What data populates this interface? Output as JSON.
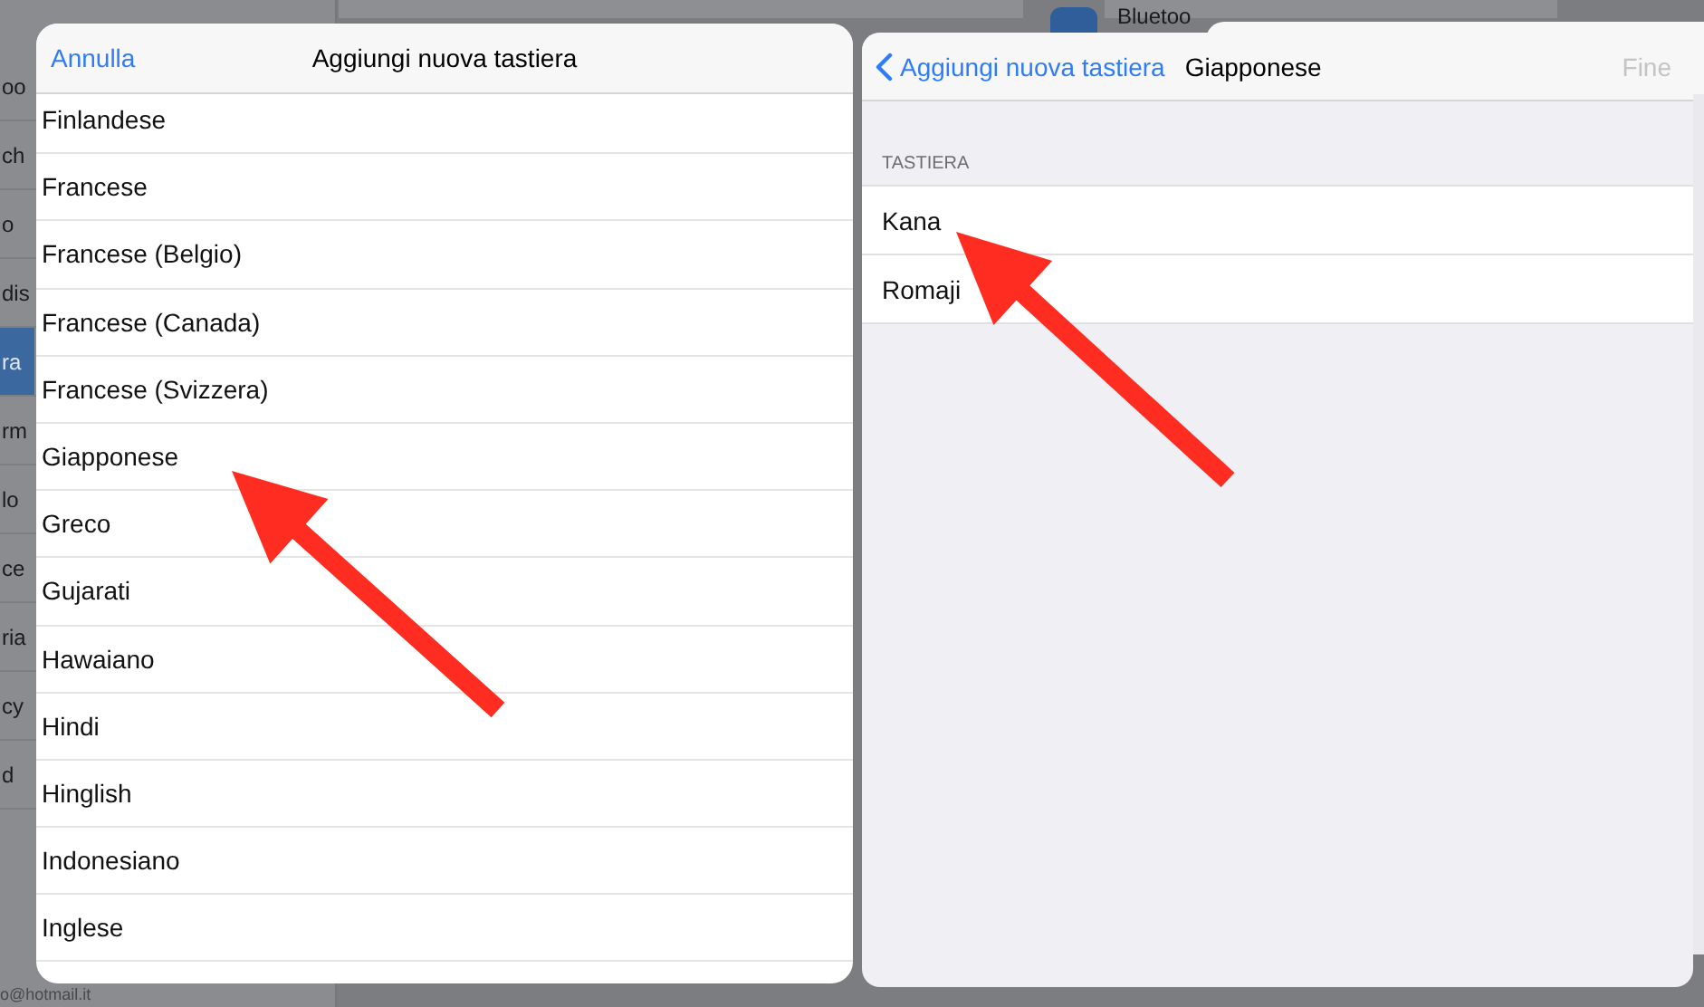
{
  "background": {
    "sidebar_fragments": [
      {
        "text": "oo",
        "selected": false
      },
      {
        "text": "ch",
        "selected": false
      },
      {
        "text": "o",
        "selected": false
      },
      {
        "text": "dis",
        "selected": false
      },
      {
        "text": "ra",
        "selected": true
      },
      {
        "text": "rm",
        "selected": false
      },
      {
        "text": "lo",
        "selected": false
      },
      {
        "text": "ce",
        "selected": false
      },
      {
        "text": "ria",
        "selected": false
      },
      {
        "text": "cy",
        "selected": false
      },
      {
        "text": "d",
        "selected": false
      }
    ],
    "account_fragment": "o@hotmail.it",
    "bluetooth_fragment": "Bluetoo"
  },
  "add_keyboard_sheet": {
    "cancel": "Annulla",
    "title": "Aggiungi nuova tastiera",
    "languages": [
      "Finlandese",
      "Francese",
      "Francese (Belgio)",
      "Francese (Canada)",
      "Francese (Svizzera)",
      "Giapponese",
      "Greco",
      "Gujarati",
      "Hawaiano",
      "Hindi",
      "Hinglish",
      "Indonesiano",
      "Inglese"
    ]
  },
  "japanese_sheet": {
    "back": "Aggiungi nuova tastiera",
    "title": "Giapponese",
    "done": "Fine",
    "done_disabled": true,
    "section": "TASTIERA",
    "keyboards": [
      "Kana",
      "Romaji"
    ]
  },
  "annotations": [
    {
      "kind": "arrow"
    },
    {
      "kind": "arrow"
    }
  ]
}
